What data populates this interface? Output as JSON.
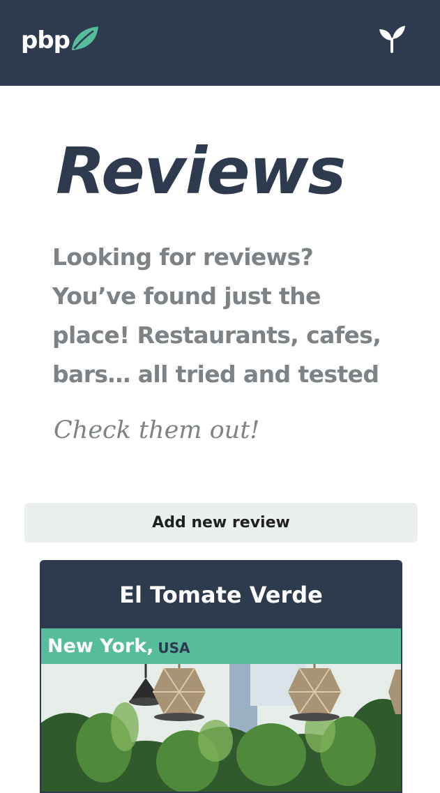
{
  "navbar": {
    "logo_text": "pbp",
    "logo_icon": "leaf-icon",
    "menu_icon": "sprout-icon",
    "background": "#2e3a4d",
    "accent": "#56bc9c"
  },
  "hero": {
    "title": "Reviews",
    "intro": "Looking for reviews? You’ve found just the place! Restaurants, cafes, bars… all tried and tested",
    "cta": "Check them out!"
  },
  "actions": {
    "add_review_label": "Add new review"
  },
  "reviews": [
    {
      "name": "El Tomate Verde",
      "city": "New York,",
      "country": "USA",
      "image_subject": "restaurant interior with pendant lamps and plants"
    }
  ]
}
